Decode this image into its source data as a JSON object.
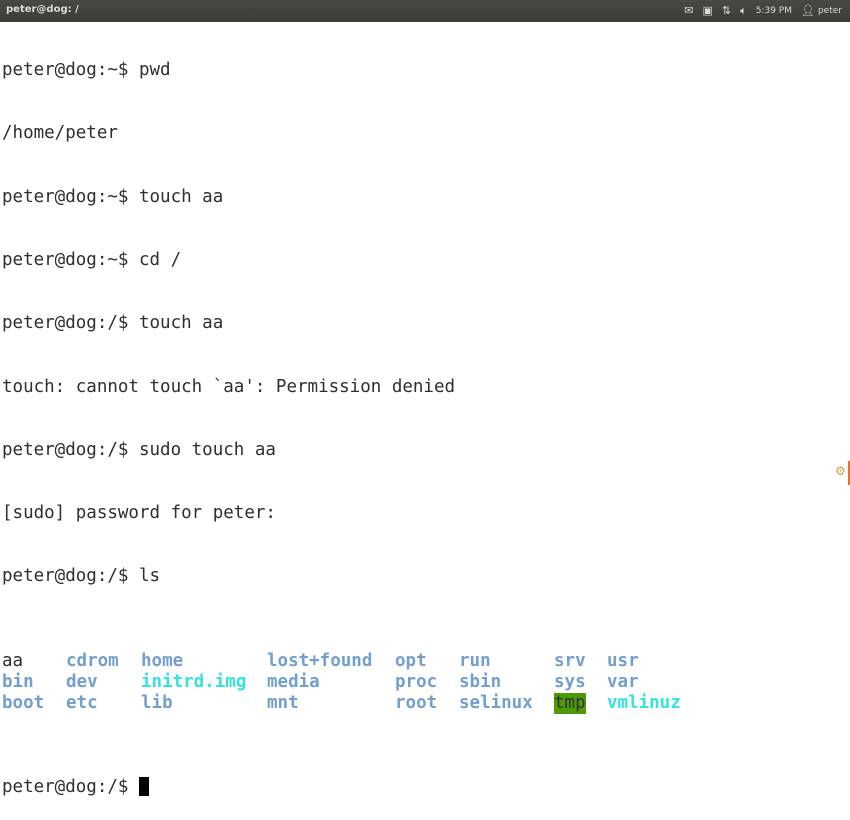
{
  "window": {
    "title": "peter@dog: /"
  },
  "indicators": {
    "mail_icon": "mail-icon",
    "keyboard_icon": "keyboard-icon",
    "network_icon": "network-icon",
    "volume_icon": "volume-icon",
    "time": "5:39 PM",
    "user_icon": "user-icon",
    "user": "peter"
  },
  "terminal": {
    "lines": [
      "peter@dog:~$ pwd",
      "/home/peter",
      "peter@dog:~$ touch aa",
      "peter@dog:~$ cd /",
      "peter@dog:/$ touch aa",
      "touch: cannot touch `aa': Permission denied",
      "peter@dog:/$ sudo touch aa",
      "[sudo] password for peter:",
      "peter@dog:/$ ls"
    ],
    "ls_rows": [
      [
        {
          "name": "aa",
          "type": "file"
        },
        {
          "name": "cdrom",
          "type": "dir"
        },
        {
          "name": "home",
          "type": "dir"
        },
        {
          "name": "lost+found",
          "type": "dir"
        },
        {
          "name": "opt",
          "type": "dir"
        },
        {
          "name": "run",
          "type": "dir"
        },
        {
          "name": "srv",
          "type": "dir"
        },
        {
          "name": "usr",
          "type": "dir"
        }
      ],
      [
        {
          "name": "bin",
          "type": "dir"
        },
        {
          "name": "dev",
          "type": "dir"
        },
        {
          "name": "initrd.img",
          "type": "link"
        },
        {
          "name": "media",
          "type": "dir"
        },
        {
          "name": "proc",
          "type": "dir"
        },
        {
          "name": "sbin",
          "type": "dir"
        },
        {
          "name": "sys",
          "type": "dir"
        },
        {
          "name": "var",
          "type": "dir"
        }
      ],
      [
        {
          "name": "boot",
          "type": "dir"
        },
        {
          "name": "etc",
          "type": "dir"
        },
        {
          "name": "lib",
          "type": "dir"
        },
        {
          "name": "mnt",
          "type": "dir"
        },
        {
          "name": "root",
          "type": "dir"
        },
        {
          "name": "selinux",
          "type": "dir"
        },
        {
          "name": "tmp",
          "type": "sticky"
        },
        {
          "name": "vmlinuz",
          "type": "link"
        }
      ]
    ],
    "prompt": "peter@dog:/$ ",
    "colors": {
      "dir": "#729fcf",
      "link": "#34e2e2",
      "sticky_bg": "#4e9a06",
      "text": "#2e2e2e"
    }
  }
}
